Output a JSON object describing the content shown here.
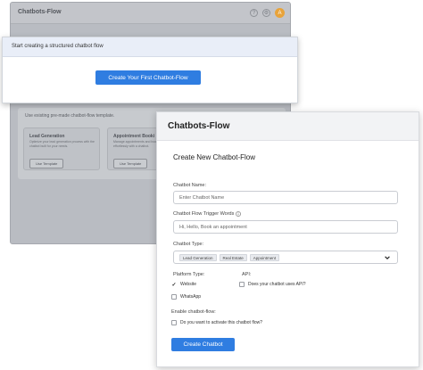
{
  "background_app": {
    "title": "Chatbots-Flow",
    "avatar_initial": "A",
    "templates_heading": "Use existing pre-made chatbot-flow template.",
    "cards": [
      {
        "title": "Lead Generation",
        "desc": "Optimize your lead generation process with the chatbot built for your needs.",
        "button": "Use Template"
      },
      {
        "title": "Appointment Booki",
        "desc": "Manage appointments and bookings effortlessly with a chatbot.",
        "button": "Use Template"
      }
    ]
  },
  "callout": {
    "bar_text": "Start creating a structured chatbot flow",
    "button_label": "Create Your First Chatbot-Flow"
  },
  "modal": {
    "title": "Chatbots-Flow",
    "form_title": "Create New Chatbot-Flow",
    "name_label": "Chatbot Name:",
    "name_placeholder": "Enter Chatbot Name",
    "trigger_label": "Chatbot Flow Trigger Words",
    "trigger_placeholder": "Hi, Hello, Book an appointment",
    "type_label": "Chatbot Type:",
    "type_tags": [
      "Lead Generation",
      "Real Estate",
      "Appointment"
    ],
    "platform_label": "Platform Type:",
    "api_label": "API:",
    "platforms": [
      {
        "label": "Website",
        "checked": true
      },
      {
        "label": "WhatsApp",
        "checked": false
      }
    ],
    "api_option": "Does your chatbot uses API?",
    "enable_label": "Enable chatbot-flow:",
    "enable_option": "Do you want to activate this chatbot flow?",
    "submit_label": "Create Chatbot"
  },
  "colors": {
    "accent": "#2f7de1"
  }
}
